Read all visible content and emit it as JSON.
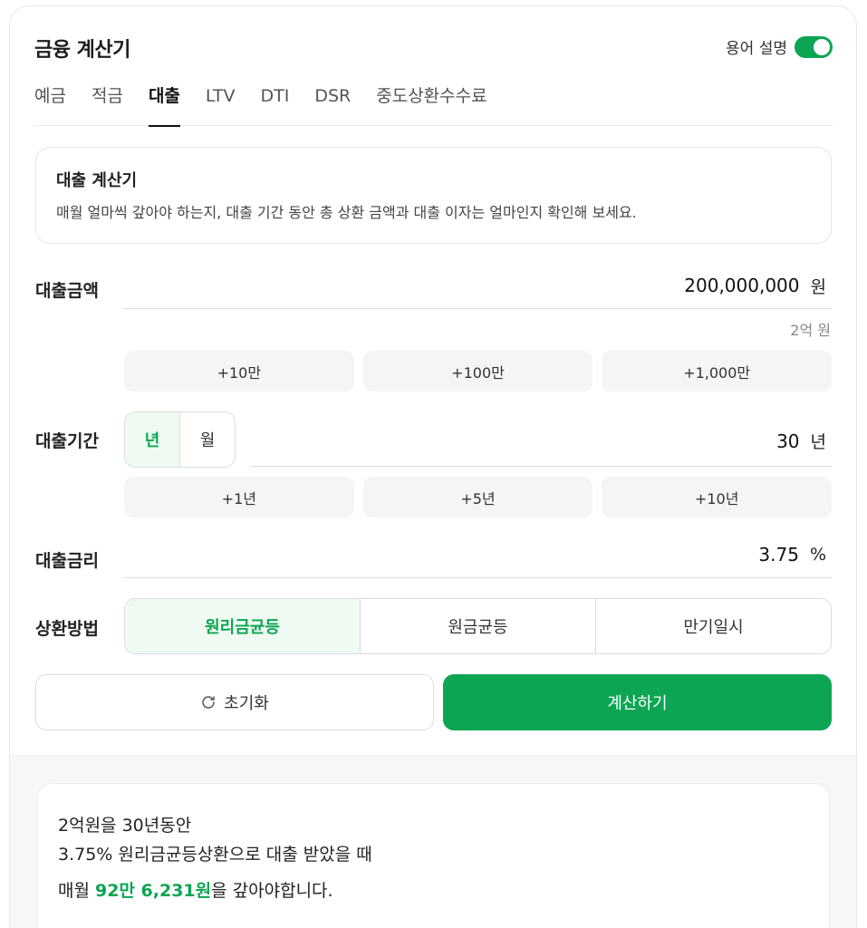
{
  "header": {
    "title": "금융 계산기",
    "term_label": "용어 설명",
    "term_toggle_on": true
  },
  "tabs": [
    {
      "label": "예금",
      "active": false
    },
    {
      "label": "적금",
      "active": false
    },
    {
      "label": "대출",
      "active": true
    },
    {
      "label": "LTV",
      "active": false
    },
    {
      "label": "DTI",
      "active": false
    },
    {
      "label": "DSR",
      "active": false
    },
    {
      "label": "중도상환수수료",
      "active": false
    }
  ],
  "intro": {
    "title": "대출 계산기",
    "desc": "매월 얼마씩 갚아야 하는지, 대출 기간 동안 총 상환 금액과 대출 이자는 얼마인지 확인해 보세요."
  },
  "amount": {
    "label": "대출금액",
    "value": "200,000,000",
    "unit": "원",
    "hint": "2억 원",
    "quick": [
      "+10만",
      "+100만",
      "+1,000만"
    ]
  },
  "period": {
    "label": "대출기간",
    "unit_options": [
      "년",
      "월"
    ],
    "unit_selected": "년",
    "value": "30",
    "unit": "년",
    "quick": [
      "+1년",
      "+5년",
      "+10년"
    ]
  },
  "rate": {
    "label": "대출금리",
    "value": "3.75",
    "unit": "%"
  },
  "method": {
    "label": "상환방법",
    "options": [
      "원리금균등",
      "원금균등",
      "만기일시"
    ],
    "selected": "원리금균등"
  },
  "buttons": {
    "reset": "초기화",
    "calc": "계산하기"
  },
  "result": {
    "line1": "2억원을 30년동안",
    "line2": "3.75% 원리금균등상환으로 대출 받았을 때",
    "line3_prefix": "매월 ",
    "line3_amount": "92만 6,231원",
    "line3_suffix": "을 갚아야합니다."
  },
  "colors": {
    "accent": "#0ca553",
    "accent_bg": "#eefaf2"
  }
}
